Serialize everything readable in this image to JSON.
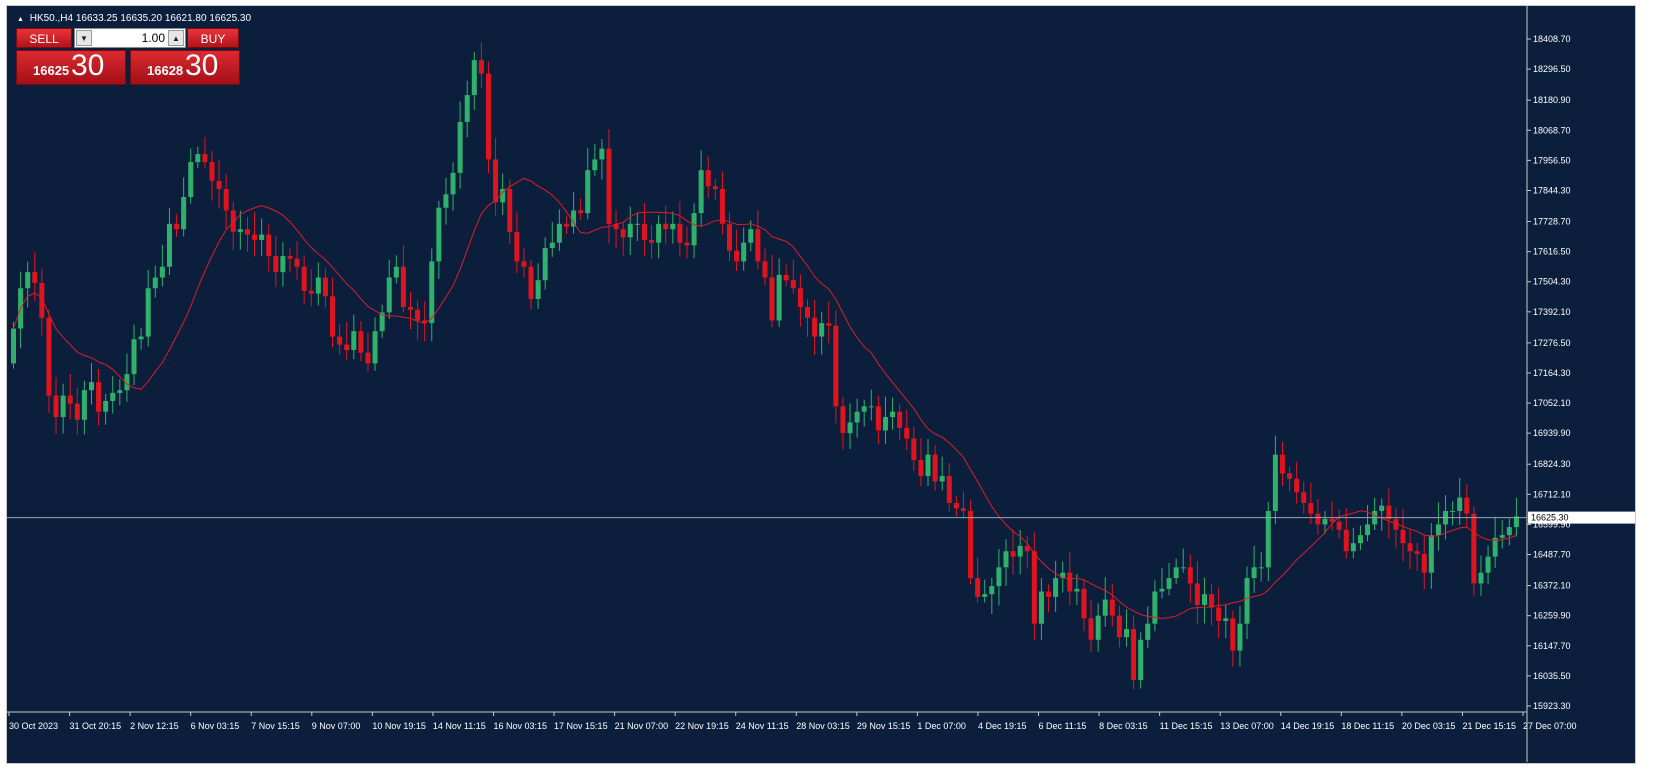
{
  "header": {
    "symbol": "HK50.,H4",
    "ohlc": "16633.25 16635.20 16621.80 16625.30"
  },
  "trade_panel": {
    "sell_label": "SELL",
    "buy_label": "BUY",
    "lot_value": "1.00",
    "sell_price_main": "16625",
    "sell_price_pips": "30",
    "buy_price_main": "16628",
    "buy_price_pips": "30"
  },
  "icons": {
    "collapse": "triangle-up-icon",
    "lot_down": "chevron-down-icon",
    "lot_up": "chevron-up-icon"
  },
  "colors": {
    "background": "#0b1f3d",
    "bull": "#2fb16b",
    "bear": "#e0141e",
    "ma": "#d81e28",
    "bid_line": "#9aa6b4",
    "axis_text": "#ffffff",
    "current_price_bg": "#ffffff",
    "current_price_text": "#000000"
  },
  "chart_data": {
    "type": "candlestick",
    "timeframe": "H4",
    "current_price": 16625.3,
    "current_price_label": "16625.30",
    "ylim": [
      15923.3,
      18464.7
    ],
    "y_ticks": [
      "18408.70",
      "18296.50",
      "18180.90",
      "18068.70",
      "17956.50",
      "17844.30",
      "17728.70",
      "17616.50",
      "17504.30",
      "17392.10",
      "17276.50",
      "17164.30",
      "17052.10",
      "16939.90",
      "16824.30",
      "16712.10",
      "16599.90",
      "16487.70",
      "16372.10",
      "16259.90",
      "16147.70",
      "16035.50",
      "15923.30"
    ],
    "x_labels": [
      "30 Oct 2023",
      "31 Oct 20:15",
      "2 Nov 12:15",
      "6 Nov 03:15",
      "7 Nov 15:15",
      "9 Nov 07:00",
      "10 Nov 19:15",
      "14 Nov 11:15",
      "16 Nov 03:15",
      "17 Nov 15:15",
      "21 Nov 07:00",
      "22 Nov 19:15",
      "24 Nov 11:15",
      "28 Nov 03:15",
      "29 Nov 15:15",
      "1 Dec 07:00",
      "4 Dec 19:15",
      "6 Dec 11:15",
      "8 Dec 03:15",
      "11 Dec 15:15",
      "13 Dec 07:00",
      "14 Dec 19:15",
      "18 Dec 11:15",
      "20 Dec 03:15",
      "21 Dec 15:15",
      "27 Dec 07:00"
    ],
    "series": [
      {
        "name": "",
        "type": "candlestick",
        "close": [
          17330,
          17480,
          17540,
          17500,
          17370,
          17080,
          17000,
          17080,
          17050,
          16990,
          17100,
          17130,
          17020,
          17060,
          17090,
          17100,
          17160,
          17290,
          17300,
          17480,
          17520,
          17560,
          17720,
          17700,
          17820,
          17950,
          17980,
          17950,
          17880,
          17850,
          17770,
          17690,
          17700,
          17680,
          17660,
          17680,
          17600,
          17540,
          17600,
          17590,
          17560,
          17470,
          17460,
          17520,
          17450,
          17300,
          17270,
          17250,
          17320,
          17240,
          17200,
          17320,
          17390,
          17520,
          17560,
          17410,
          17400,
          17360,
          17350,
          17580,
          17780,
          17830,
          17910,
          18100,
          18200,
          18330,
          18280,
          17960,
          17800,
          17850,
          17690,
          17580,
          17560,
          17440,
          17510,
          17630,
          17650,
          17720,
          17710,
          17770,
          17760,
          17920,
          17960,
          18000,
          17720,
          17700,
          17670,
          17720,
          17720,
          17660,
          17650,
          17720,
          17700,
          17720,
          17650,
          17640,
          17760,
          17920,
          17860,
          17850,
          17720,
          17620,
          17580,
          17650,
          17700,
          17580,
          17520,
          17360,
          17530,
          17510,
          17480,
          17410,
          17370,
          17300,
          17350,
          17340,
          17040,
          16940,
          16980,
          17020,
          17040,
          17040,
          16950,
          17000,
          17020,
          16960,
          16920,
          16840,
          16780,
          16860,
          16760,
          16780,
          16680,
          16660,
          16650,
          16400,
          16330,
          16340,
          16370,
          16440,
          16500,
          16480,
          16520,
          16500,
          16230,
          16350,
          16330,
          16400,
          16420,
          16350,
          16360,
          16250,
          16170,
          16260,
          16320,
          16260,
          16180,
          16210,
          16020,
          16170,
          16230,
          16350,
          16360,
          16400,
          16440,
          16440,
          16380,
          16300,
          16340,
          16290,
          16240,
          16250,
          16130,
          16230,
          16400,
          16440,
          16440,
          16650,
          16860,
          16790,
          16770,
          16720,
          16680,
          16640,
          16600,
          16620,
          16610,
          16580,
          16500,
          16530,
          16560,
          16600,
          16650,
          16670,
          16620,
          16580,
          16530,
          16500,
          16490,
          16420,
          16560,
          16600,
          16650,
          16650,
          16700,
          16640,
          16380,
          16420,
          16480,
          16550,
          16560,
          16590,
          16630
        ],
        "open": [
          17200,
          17330,
          17480,
          17540,
          17500,
          17370,
          17080,
          17000,
          17080,
          17050,
          16990,
          17100,
          17130,
          17020,
          17060,
          17090,
          17100,
          17160,
          17290,
          17300,
          17480,
          17520,
          17560,
          17720,
          17700,
          17820,
          17950,
          17980,
          17950,
          17880,
          17850,
          17770,
          17690,
          17700,
          17680,
          17660,
          17680,
          17600,
          17540,
          17600,
          17590,
          17560,
          17470,
          17460,
          17520,
          17450,
          17300,
          17270,
          17250,
          17320,
          17240,
          17200,
          17320,
          17390,
          17520,
          17560,
          17410,
          17400,
          17360,
          17350,
          17580,
          17780,
          17830,
          17910,
          18100,
          18200,
          18330,
          18280,
          17960,
          17800,
          17850,
          17690,
          17580,
          17560,
          17440,
          17510,
          17630,
          17650,
          17720,
          17710,
          17770,
          17760,
          17920,
          17960,
          18000,
          17720,
          17700,
          17670,
          17720,
          17720,
          17660,
          17650,
          17720,
          17700,
          17720,
          17650,
          17640,
          17760,
          17920,
          17860,
          17850,
          17720,
          17620,
          17580,
          17650,
          17700,
          17580,
          17520,
          17360,
          17530,
          17510,
          17480,
          17410,
          17370,
          17300,
          17350,
          17340,
          17040,
          16940,
          16980,
          17020,
          17040,
          17040,
          16950,
          17000,
          17020,
          16960,
          16920,
          16840,
          16780,
          16860,
          16760,
          16780,
          16680,
          16660,
          16650,
          16400,
          16330,
          16340,
          16370,
          16440,
          16500,
          16480,
          16520,
          16500,
          16230,
          16350,
          16330,
          16400,
          16420,
          16350,
          16360,
          16250,
          16170,
          16260,
          16320,
          16260,
          16180,
          16210,
          16020,
          16170,
          16230,
          16350,
          16360,
          16400,
          16440,
          16440,
          16380,
          16300,
          16340,
          16290,
          16240,
          16250,
          16130,
          16230,
          16400,
          16440,
          16440,
          16650,
          16860,
          16790,
          16770,
          16720,
          16680,
          16640,
          16600,
          16620,
          16610,
          16580,
          16500,
          16530,
          16560,
          16600,
          16650,
          16670,
          16620,
          16580,
          16530,
          16500,
          16490,
          16420,
          16560,
          16600,
          16650,
          16650,
          16700,
          16640,
          16380,
          16420,
          16480,
          16550,
          16560,
          16590
        ]
      },
      {
        "name": "",
        "type": "line",
        "values": []
      }
    ]
  }
}
